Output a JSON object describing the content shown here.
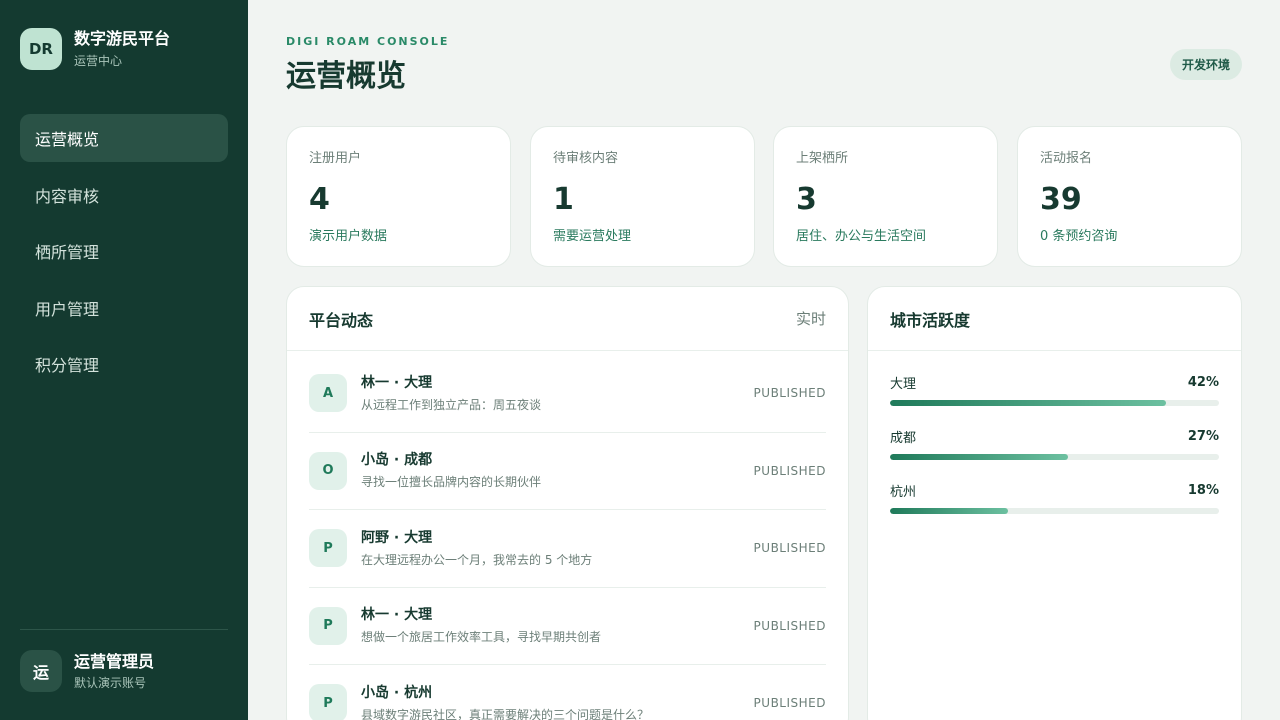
{
  "brand": {
    "logo": "DR",
    "name": "数字游民平台",
    "subtitle": "运营中心"
  },
  "nav": [
    {
      "label": "运营概览",
      "active": true
    },
    {
      "label": "内容审核",
      "active": false
    },
    {
      "label": "栖所管理",
      "active": false
    },
    {
      "label": "用户管理",
      "active": false
    },
    {
      "label": "积分管理",
      "active": false
    }
  ],
  "user": {
    "avatar": "运",
    "name": "运营管理员",
    "subtitle": "默认演示账号"
  },
  "header": {
    "eyebrow": "DIGI ROAM CONSOLE",
    "title": "运营概览",
    "env_badge": "开发环境"
  },
  "stats": [
    {
      "label": "注册用户",
      "value": "4",
      "note": "演示用户数据"
    },
    {
      "label": "待审核内容",
      "value": "1",
      "note": "需要运营处理"
    },
    {
      "label": "上架栖所",
      "value": "3",
      "note": "居住、办公与生活空间"
    },
    {
      "label": "活动报名",
      "value": "39",
      "note": "0 条预约咨询"
    }
  ],
  "feed": {
    "title": "平台动态",
    "extra": "实时",
    "items": [
      {
        "avatar": "A",
        "title": "林一 · 大理",
        "desc": "从远程工作到独立产品：周五夜谈",
        "status": "PUBLISHED"
      },
      {
        "avatar": "O",
        "title": "小岛 · 成都",
        "desc": "寻找一位擅长品牌内容的长期伙伴",
        "status": "PUBLISHED"
      },
      {
        "avatar": "P",
        "title": "阿野 · 大理",
        "desc": "在大理远程办公一个月，我常去的 5 个地方",
        "status": "PUBLISHED"
      },
      {
        "avatar": "P",
        "title": "林一 · 大理",
        "desc": "想做一个旅居工作效率工具，寻找早期共创者",
        "status": "PUBLISHED"
      },
      {
        "avatar": "P",
        "title": "小岛 · 杭州",
        "desc": "县域数字游民社区，真正需要解决的三个问题是什么？",
        "status": "PUBLISHED"
      }
    ]
  },
  "cities": {
    "title": "城市活跃度",
    "items": [
      {
        "name": "大理",
        "percent": "42%",
        "fill": 0.84
      },
      {
        "name": "成都",
        "percent": "27%",
        "fill": 0.54
      },
      {
        "name": "杭州",
        "percent": "18%",
        "fill": 0.36
      }
    ]
  },
  "colors": {
    "sidebar": "#143a30",
    "accent": "#1f7a5a",
    "page": "#f1f4f2"
  }
}
